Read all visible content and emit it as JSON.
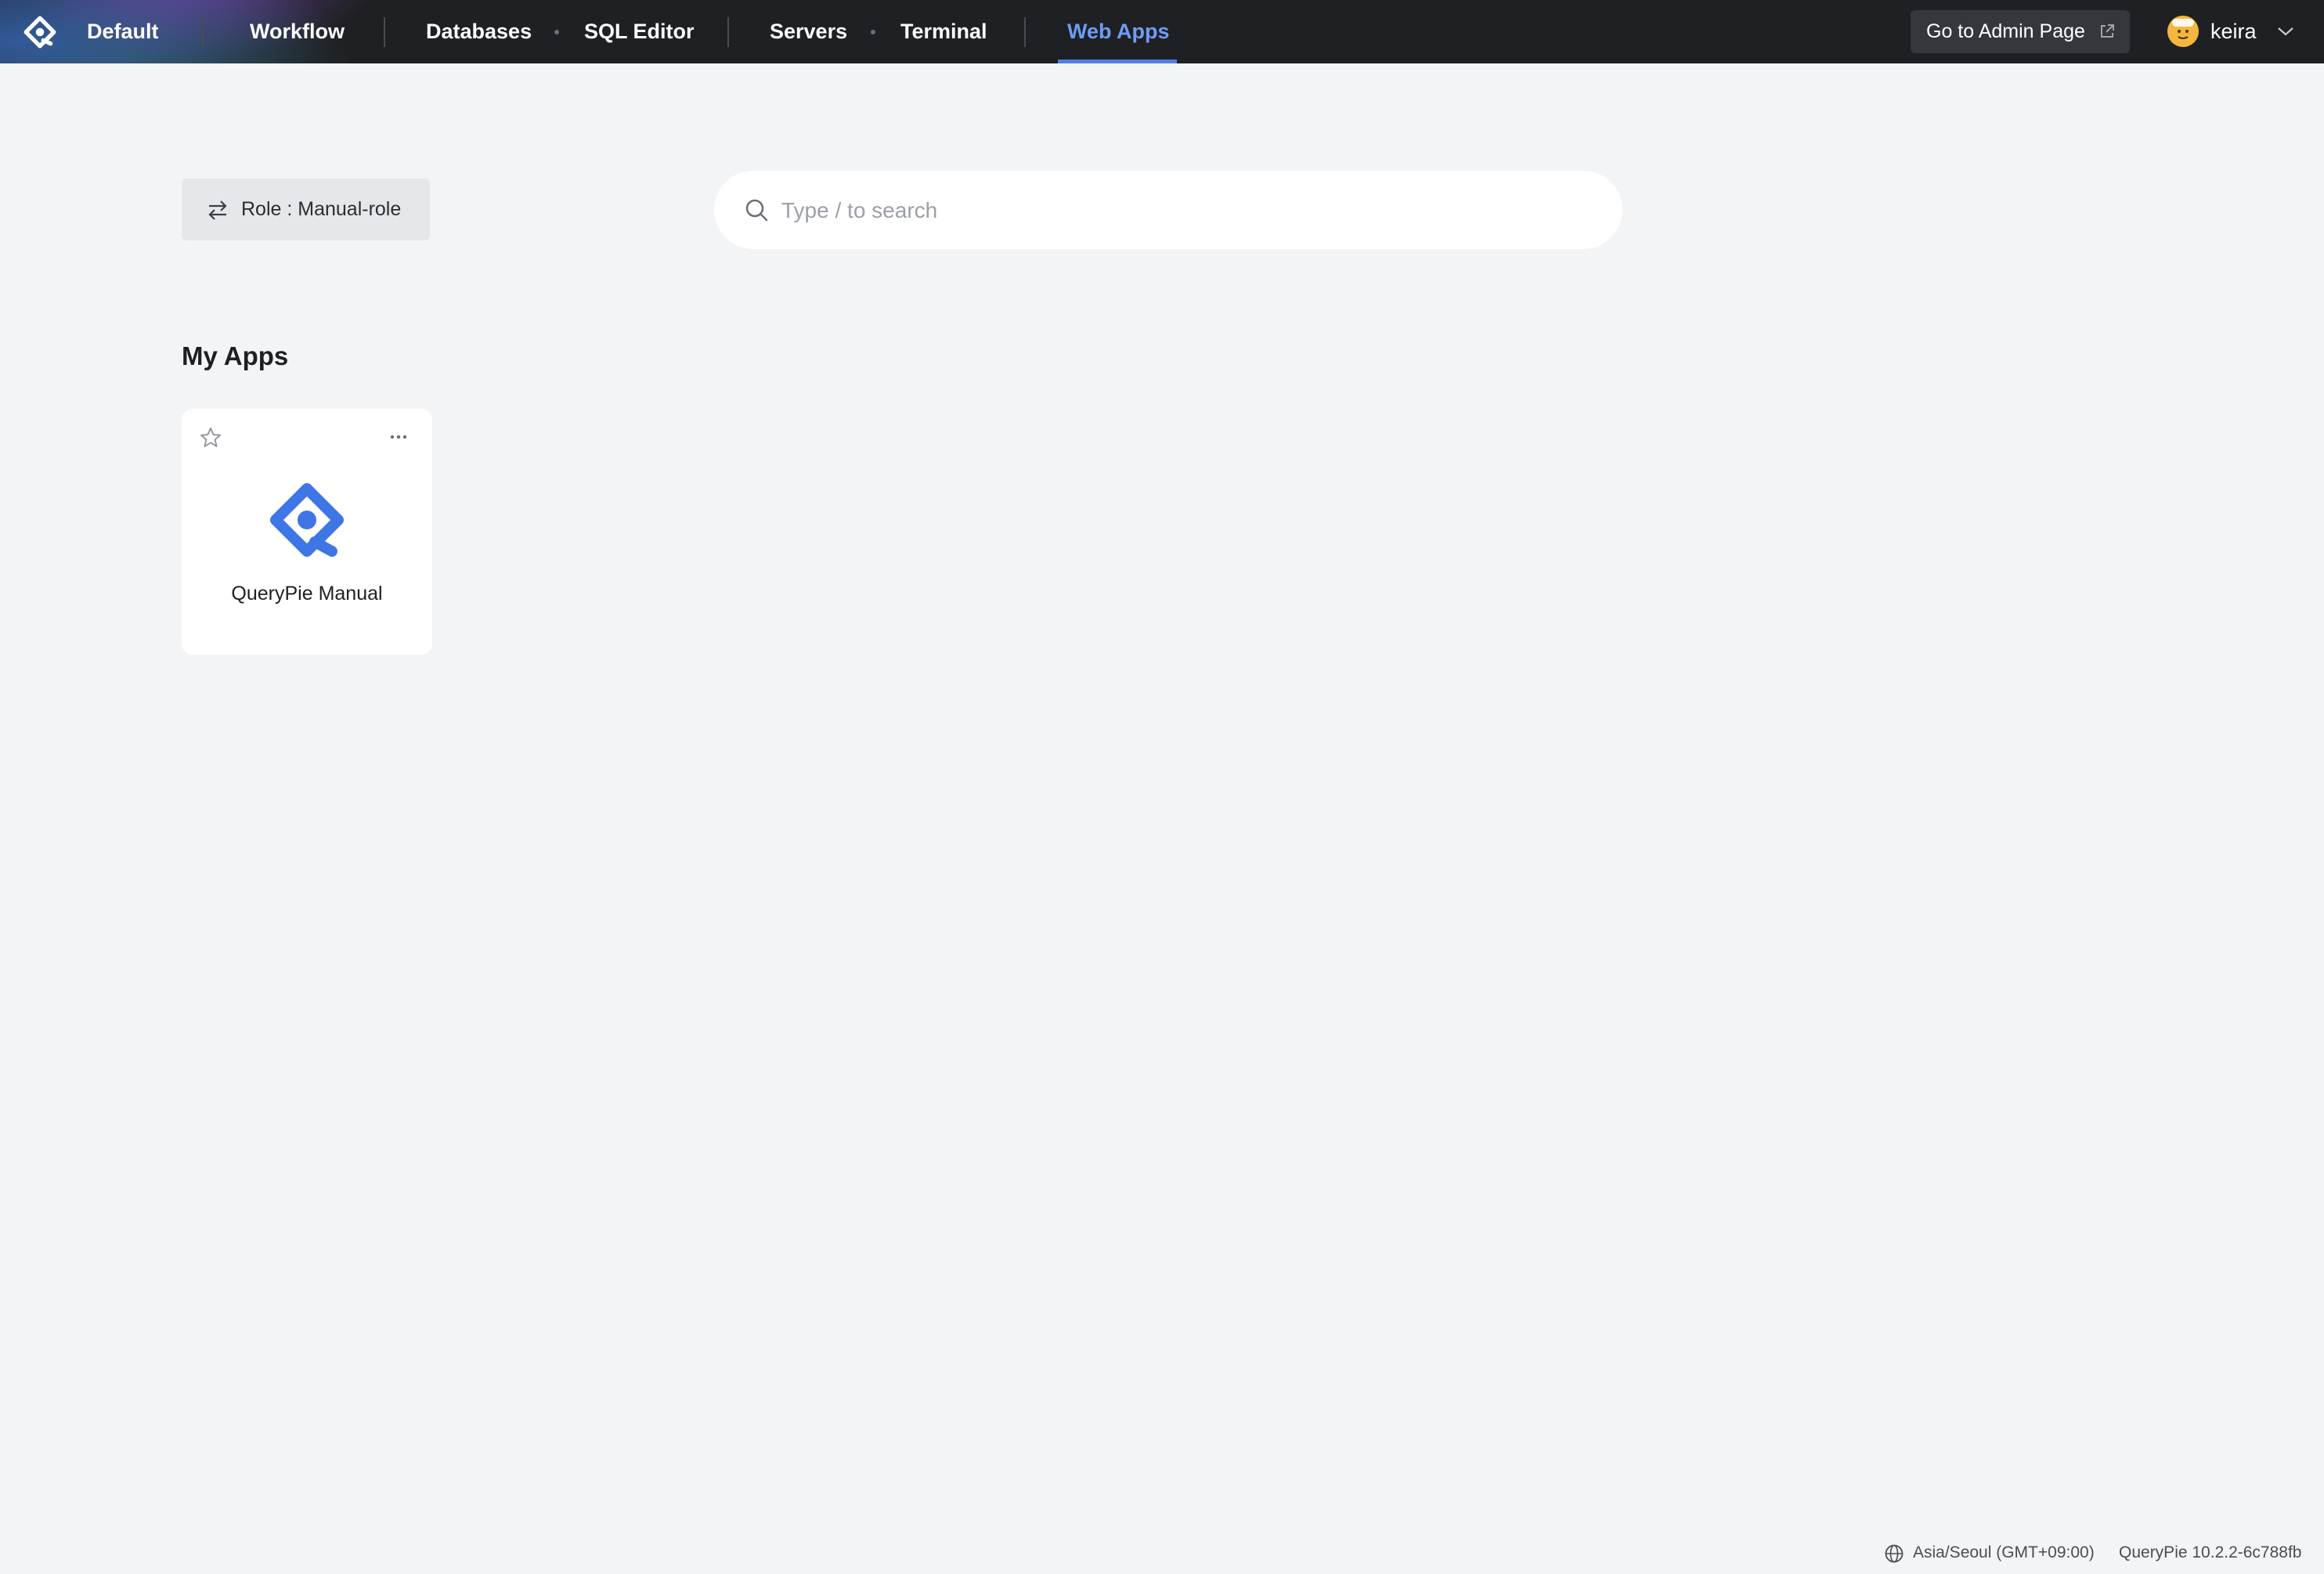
{
  "nav": {
    "workspace": "Default",
    "items": [
      {
        "label": "Workflow"
      },
      {
        "label": "Databases"
      },
      {
        "label": "SQL Editor"
      },
      {
        "label": "Servers"
      },
      {
        "label": "Terminal"
      },
      {
        "label": "Web Apps",
        "active": true
      }
    ],
    "admin_button": "Go to Admin Page",
    "user": "keira",
    "icons": {
      "logo": "querypie-logo-icon",
      "admin": "external-link-icon",
      "user_menu": "chevron-down-icon"
    }
  },
  "role": {
    "label": "Role : Manual-role",
    "icon": "swap-arrows-icon"
  },
  "search": {
    "placeholder": "Type / to search",
    "value": "",
    "icon": "search-icon"
  },
  "my_apps": {
    "title": "My Apps",
    "apps": [
      {
        "name": "QueryPie Manual",
        "favorite": false,
        "icons": [
          "star-icon",
          "more-options-icon",
          "querypie-app-logo-icon"
        ]
      }
    ]
  },
  "footer": {
    "timezone": "Asia/Seoul (GMT+09:00)",
    "version": "QueryPie 10.2.2-6c788fb",
    "icon": "globe-icon"
  },
  "colors": {
    "topbar_bg": "#1f2023",
    "page_bg": "#f3f4f6",
    "accent": "#4f7fe8",
    "active_nav_text": "#6f9cf5",
    "logo_blue": "#3f76e6"
  }
}
